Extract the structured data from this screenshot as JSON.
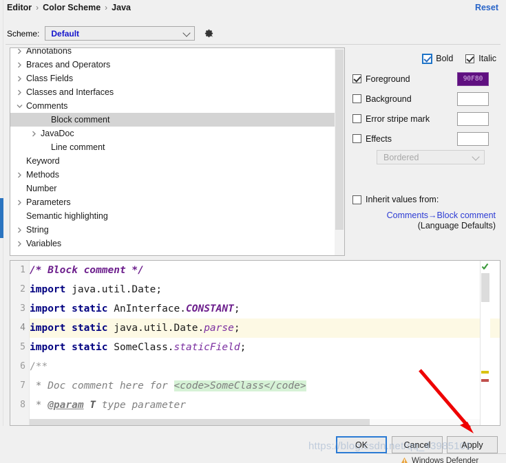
{
  "header": {
    "breadcrumb": [
      "Editor",
      "Color Scheme",
      "Java"
    ],
    "separator": "›",
    "reset_label": "Reset"
  },
  "scheme": {
    "label": "Scheme:",
    "value": "Default",
    "gear_icon": "gear-icon",
    "options": [
      "Default"
    ]
  },
  "tree": {
    "items": [
      {
        "label": "Annotations",
        "level": 0,
        "twisty": "collapsed",
        "selected": false
      },
      {
        "label": "Braces and Operators",
        "level": 0,
        "twisty": "collapsed",
        "selected": false
      },
      {
        "label": "Class Fields",
        "level": 0,
        "twisty": "collapsed",
        "selected": false
      },
      {
        "label": "Classes and Interfaces",
        "level": 0,
        "twisty": "collapsed",
        "selected": false
      },
      {
        "label": "Comments",
        "level": 0,
        "twisty": "expanded",
        "selected": false
      },
      {
        "label": "Block comment",
        "level": 2,
        "twisty": "none",
        "selected": true
      },
      {
        "label": "JavaDoc",
        "level": 1,
        "twisty": "collapsed",
        "selected": false
      },
      {
        "label": "Line comment",
        "level": 2,
        "twisty": "none",
        "selected": false
      },
      {
        "label": "Keyword",
        "level": 0,
        "twisty": "none",
        "selected": false
      },
      {
        "label": "Methods",
        "level": 0,
        "twisty": "collapsed",
        "selected": false
      },
      {
        "label": "Number",
        "level": 0,
        "twisty": "none",
        "selected": false
      },
      {
        "label": "Parameters",
        "level": 0,
        "twisty": "collapsed",
        "selected": false
      },
      {
        "label": "Semantic highlighting",
        "level": 0,
        "twisty": "none",
        "selected": false
      },
      {
        "label": "String",
        "level": 0,
        "twisty": "collapsed",
        "selected": false
      },
      {
        "label": "Variables",
        "level": 0,
        "twisty": "collapsed",
        "selected": false
      }
    ]
  },
  "settings": {
    "bold": {
      "label": "Bold",
      "checked": true,
      "focused": true
    },
    "italic": {
      "label": "Italic",
      "checked": true,
      "focused": false
    },
    "foreground": {
      "label": "Foreground",
      "checked": true,
      "swatch_text": "90F80",
      "swatch_color": "#5f0f80"
    },
    "background": {
      "label": "Background",
      "checked": false,
      "swatch_text": "",
      "swatch_color": "#ffffff"
    },
    "error_stripe": {
      "label": "Error stripe mark",
      "checked": false,
      "swatch_text": "",
      "swatch_color": "#ffffff"
    },
    "effects": {
      "label": "Effects",
      "checked": false,
      "swatch_text": "",
      "swatch_color": "#ffffff"
    },
    "effects_type": {
      "value": "Bordered",
      "options": [
        "Bordered"
      ]
    },
    "inherit": {
      "label": "Inherit values from:",
      "checked": false,
      "link": "Comments→Block comment",
      "sub": "(Language Defaults)"
    }
  },
  "preview": {
    "lines": [
      {
        "number": "1",
        "highlighted": false,
        "tokens": [
          {
            "t": "/* Block comment */",
            "c": "tok-comment"
          }
        ]
      },
      {
        "number": "2",
        "highlighted": false,
        "tokens": [
          {
            "t": "import",
            "c": "tok-kw"
          },
          {
            "t": " java.util.Date;",
            "c": "tok-plain"
          }
        ]
      },
      {
        "number": "3",
        "highlighted": false,
        "tokens": [
          {
            "t": "import static",
            "c": "tok-kw"
          },
          {
            "t": " AnInterface.",
            "c": "tok-plain"
          },
          {
            "t": "CONSTANT",
            "c": "tok-static"
          },
          {
            "t": ";",
            "c": "tok-plain"
          }
        ]
      },
      {
        "number": "4",
        "highlighted": true,
        "tokens": [
          {
            "t": "import static",
            "c": "tok-kw"
          },
          {
            "t": " java.util.Date.",
            "c": "tok-plain"
          },
          {
            "t": "parse",
            "c": "tok-field"
          },
          {
            "t": ";",
            "c": "tok-plain"
          }
        ]
      },
      {
        "number": "5",
        "highlighted": false,
        "tokens": [
          {
            "t": "import static",
            "c": "tok-kw"
          },
          {
            "t": " SomeClass.",
            "c": "tok-plain"
          },
          {
            "t": "staticField",
            "c": "tok-field"
          },
          {
            "t": ";",
            "c": "tok-plain"
          }
        ]
      },
      {
        "number": "6",
        "highlighted": false,
        "tokens": [
          {
            "t": "/**",
            "c": "tok-grey"
          }
        ]
      },
      {
        "number": "7",
        "highlighted": false,
        "tokens": [
          {
            "t": " * Doc comment here for ",
            "c": "tok-doc"
          },
          {
            "t": "<code>SomeClass</code>",
            "c": "tok-code-hl"
          }
        ]
      },
      {
        "number": "8",
        "highlighted": false,
        "tokens": [
          {
            "t": " * ",
            "c": "tok-doc"
          },
          {
            "t": "@param",
            "c": "tok-doctag"
          },
          {
            "t": " ",
            "c": "tok-doc"
          },
          {
            "t": "T",
            "c": "tok-docT"
          },
          {
            "t": " type parameter",
            "c": "tok-doc"
          }
        ]
      }
    ],
    "inspection_icon": "inspection-ok-icon"
  },
  "footer": {
    "ok": "OK",
    "cancel": "Cancel",
    "apply": "Apply"
  },
  "overlay": {
    "watermark": "https://blog.csdn.net/qq_43985101",
    "taskbar": "Windows Defender",
    "arrow": "red-arrow-annotation"
  }
}
